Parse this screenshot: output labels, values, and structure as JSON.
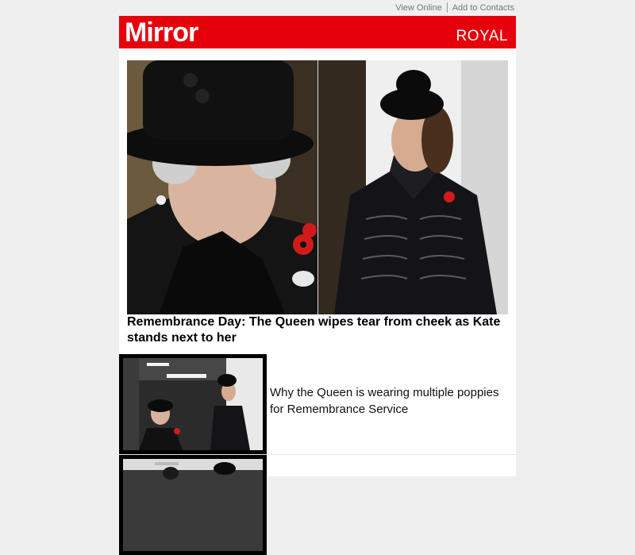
{
  "header": {
    "view_online": "View Online",
    "add_to_contacts": "Add to Contacts",
    "logo_text": "Mirror",
    "section_label": "ROYAL"
  },
  "colors": {
    "brand_red": "#e6000b",
    "poppy_red": "#d11a1a"
  },
  "main_story": {
    "headline": "Remembrance Day: The Queen wipes tear from cheek as Kate stands next to her"
  },
  "stories": [
    {
      "title": "Why the Queen is wearing multiple poppies for Remembrance Service"
    },
    {
      "title": ""
    }
  ]
}
